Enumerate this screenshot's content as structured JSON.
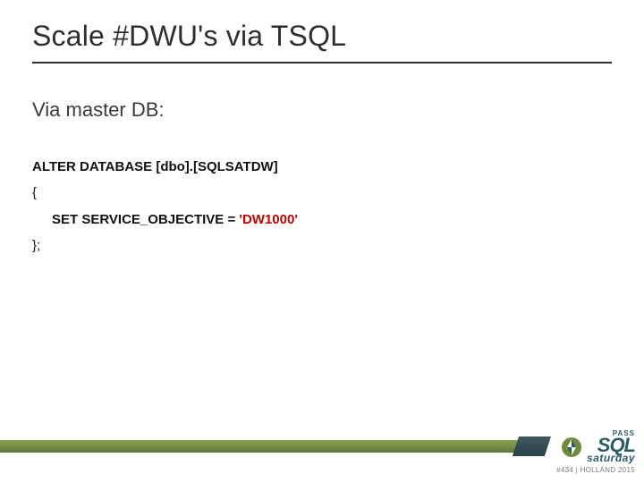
{
  "title": "Scale #DWU's via TSQL",
  "subhead": "Via master DB:",
  "code": {
    "line1": "ALTER DATABASE [dbo].[SQLSATDW]",
    "open": "{",
    "set_label": "SET SERVICE_OBJECTIVE",
    "eq": " = ",
    "value": "'DW1000'",
    "close": "};"
  },
  "logo": {
    "pass": "PASS",
    "sql": "SQL",
    "saturday": "saturday",
    "event": "#434 | HOLLAND 2015"
  }
}
